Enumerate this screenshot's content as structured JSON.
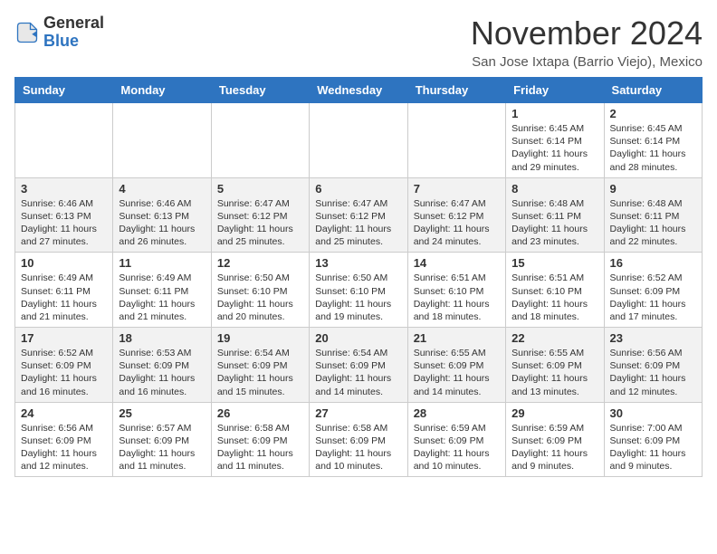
{
  "header": {
    "logo_general": "General",
    "logo_blue": "Blue",
    "month_title": "November 2024",
    "location": "San Jose Ixtapa (Barrio Viejo), Mexico"
  },
  "days_of_week": [
    "Sunday",
    "Monday",
    "Tuesday",
    "Wednesday",
    "Thursday",
    "Friday",
    "Saturday"
  ],
  "weeks": [
    [
      {
        "day": "",
        "info": ""
      },
      {
        "day": "",
        "info": ""
      },
      {
        "day": "",
        "info": ""
      },
      {
        "day": "",
        "info": ""
      },
      {
        "day": "",
        "info": ""
      },
      {
        "day": "1",
        "info": "Sunrise: 6:45 AM\nSunset: 6:14 PM\nDaylight: 11 hours and 29 minutes."
      },
      {
        "day": "2",
        "info": "Sunrise: 6:45 AM\nSunset: 6:14 PM\nDaylight: 11 hours and 28 minutes."
      }
    ],
    [
      {
        "day": "3",
        "info": "Sunrise: 6:46 AM\nSunset: 6:13 PM\nDaylight: 11 hours and 27 minutes."
      },
      {
        "day": "4",
        "info": "Sunrise: 6:46 AM\nSunset: 6:13 PM\nDaylight: 11 hours and 26 minutes."
      },
      {
        "day": "5",
        "info": "Sunrise: 6:47 AM\nSunset: 6:12 PM\nDaylight: 11 hours and 25 minutes."
      },
      {
        "day": "6",
        "info": "Sunrise: 6:47 AM\nSunset: 6:12 PM\nDaylight: 11 hours and 25 minutes."
      },
      {
        "day": "7",
        "info": "Sunrise: 6:47 AM\nSunset: 6:12 PM\nDaylight: 11 hours and 24 minutes."
      },
      {
        "day": "8",
        "info": "Sunrise: 6:48 AM\nSunset: 6:11 PM\nDaylight: 11 hours and 23 minutes."
      },
      {
        "day": "9",
        "info": "Sunrise: 6:48 AM\nSunset: 6:11 PM\nDaylight: 11 hours and 22 minutes."
      }
    ],
    [
      {
        "day": "10",
        "info": "Sunrise: 6:49 AM\nSunset: 6:11 PM\nDaylight: 11 hours and 21 minutes."
      },
      {
        "day": "11",
        "info": "Sunrise: 6:49 AM\nSunset: 6:11 PM\nDaylight: 11 hours and 21 minutes."
      },
      {
        "day": "12",
        "info": "Sunrise: 6:50 AM\nSunset: 6:10 PM\nDaylight: 11 hours and 20 minutes."
      },
      {
        "day": "13",
        "info": "Sunrise: 6:50 AM\nSunset: 6:10 PM\nDaylight: 11 hours and 19 minutes."
      },
      {
        "day": "14",
        "info": "Sunrise: 6:51 AM\nSunset: 6:10 PM\nDaylight: 11 hours and 18 minutes."
      },
      {
        "day": "15",
        "info": "Sunrise: 6:51 AM\nSunset: 6:10 PM\nDaylight: 11 hours and 18 minutes."
      },
      {
        "day": "16",
        "info": "Sunrise: 6:52 AM\nSunset: 6:09 PM\nDaylight: 11 hours and 17 minutes."
      }
    ],
    [
      {
        "day": "17",
        "info": "Sunrise: 6:52 AM\nSunset: 6:09 PM\nDaylight: 11 hours and 16 minutes."
      },
      {
        "day": "18",
        "info": "Sunrise: 6:53 AM\nSunset: 6:09 PM\nDaylight: 11 hours and 16 minutes."
      },
      {
        "day": "19",
        "info": "Sunrise: 6:54 AM\nSunset: 6:09 PM\nDaylight: 11 hours and 15 minutes."
      },
      {
        "day": "20",
        "info": "Sunrise: 6:54 AM\nSunset: 6:09 PM\nDaylight: 11 hours and 14 minutes."
      },
      {
        "day": "21",
        "info": "Sunrise: 6:55 AM\nSunset: 6:09 PM\nDaylight: 11 hours and 14 minutes."
      },
      {
        "day": "22",
        "info": "Sunrise: 6:55 AM\nSunset: 6:09 PM\nDaylight: 11 hours and 13 minutes."
      },
      {
        "day": "23",
        "info": "Sunrise: 6:56 AM\nSunset: 6:09 PM\nDaylight: 11 hours and 12 minutes."
      }
    ],
    [
      {
        "day": "24",
        "info": "Sunrise: 6:56 AM\nSunset: 6:09 PM\nDaylight: 11 hours and 12 minutes."
      },
      {
        "day": "25",
        "info": "Sunrise: 6:57 AM\nSunset: 6:09 PM\nDaylight: 11 hours and 11 minutes."
      },
      {
        "day": "26",
        "info": "Sunrise: 6:58 AM\nSunset: 6:09 PM\nDaylight: 11 hours and 11 minutes."
      },
      {
        "day": "27",
        "info": "Sunrise: 6:58 AM\nSunset: 6:09 PM\nDaylight: 11 hours and 10 minutes."
      },
      {
        "day": "28",
        "info": "Sunrise: 6:59 AM\nSunset: 6:09 PM\nDaylight: 11 hours and 10 minutes."
      },
      {
        "day": "29",
        "info": "Sunrise: 6:59 AM\nSunset: 6:09 PM\nDaylight: 11 hours and 9 minutes."
      },
      {
        "day": "30",
        "info": "Sunrise: 7:00 AM\nSunset: 6:09 PM\nDaylight: 11 hours and 9 minutes."
      }
    ]
  ]
}
